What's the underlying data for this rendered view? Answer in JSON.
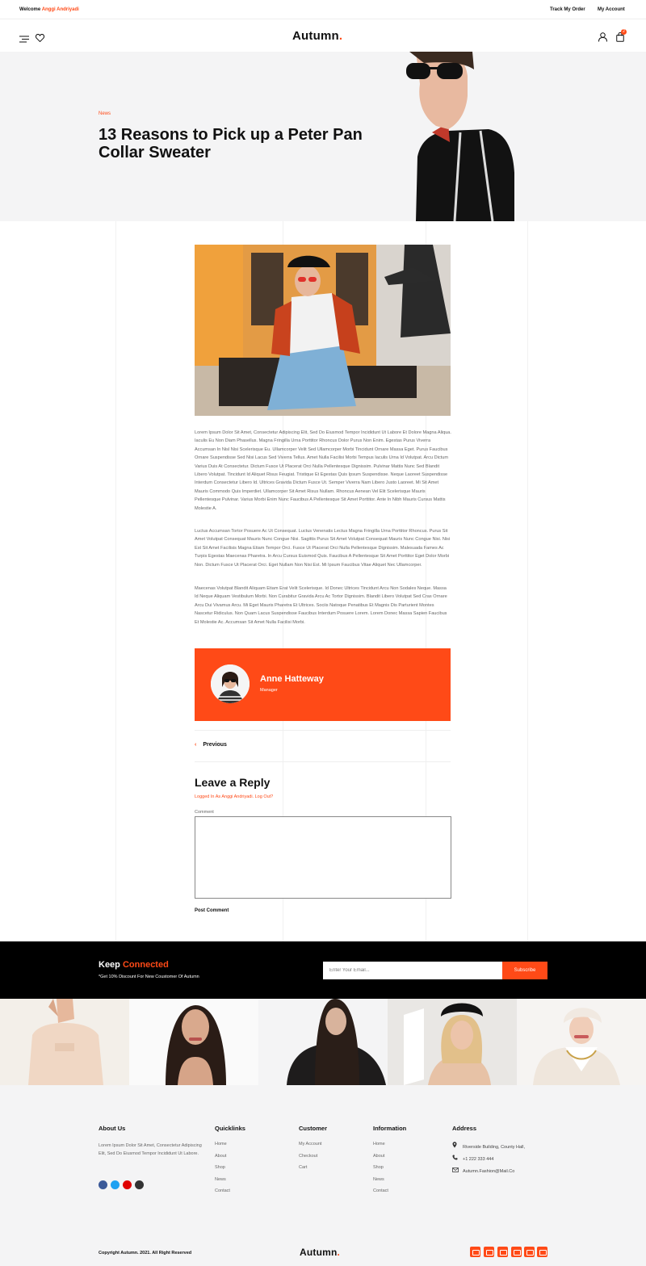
{
  "topbar": {
    "welcome_prefix": "Welcome",
    "welcome_user": "Anggi Andriyadi",
    "track_order": "Track My Order",
    "my_account": "My Account"
  },
  "header": {
    "logo": "Autumn",
    "logo_dot": ".",
    "cart_count": "2",
    "icons": [
      "menu-icon",
      "heart-icon",
      "user-icon",
      "cart-icon"
    ]
  },
  "hero": {
    "category": "News",
    "title": "13 Reasons to Pick up a Peter Pan Collar Sweater"
  },
  "article": {
    "paragraphs": [
      "Lorem Ipsum Dolor Sit Amet, Consectetur Adipiscing Elit, Sed Do Eiusmod Tempor Incididunt Ut Labore Et Dolore Magna Aliqua. Iaculis Eu Non Diam Phasellus. Magna Fringilla Urna Porttitor Rhoncus Dolor Purus Non Enim. Egestas Purus Viverra Accumsan In Nisl Nisi Scelerisque Eu. Ullamcorper Velit Sed Ullamcorper Morbi Tincidunt Ornare Massa Eget. Purus Faucibus Ornare Suspendisse Sed Nisi Lacus Sed Viverra Tellus. Amet Nulla Facilisi Morbi Tempus Iaculis Urna Id Volutpat. Arcu Dictum Varius Duis At Consectetur. Dictum Fusce Ut Placerat Orci Nulla Pellentesque Dignissim. Pulvinar Mattis Nunc Sed Blandit Libero Volutpat. Tincidunt Id Aliquet Risus Feugiat. Tristique Et Egestas Quis Ipsum Suspendisse. Neque Laoreet Suspendisse Interdum Consectetur Libero Id. Ultrices Gravida Dictum Fusce Ut. Semper Viverra Nam Libero Justo Laoreet. Mi Sit Amet Mauris Commodo Quis Imperdiet. Ullamcorper Sit Amet Risus Nullam. Rhoncus Aenean Vel Elit Scelerisque Mauris Pellentesque Pulvinar. Varius Morbi Enim Nunc Faucibus A Pellentesque Sit Amet Porttitor. Ante In Nibh Mauris Cursus Mattis Molestie A.",
      "Luctus Accumsan Tortor Posuere Ac Ut Consequat. Luctus Venenatis Lectus Magna Fringilla Urna Porttitor Rhoncus. Purus Sit Amet Volutpat Consequat Mauris Nunc Congue Nisi. Sagittis Purus Sit Amet Volutpat Consequat Mauris Nunc Congue Nisi. Nisi Est Sit Amet Facilisis Magna Etiam Tempor Orci. Fusce Ut Placerat Orci Nulla Pellentesque Dignissim. Malesuada Fames Ac Turpis Egestas Maecenas Pharetra. In Arcu Cursus Euismod Quis. Faucibus A Pellentesque Sit Amet Porttitor Eget Dolor Morbi Non. Dictum Fusce Ut Placerat Orci. Eget Nullam Non Nisi Est. Mi Ipsum Faucibus Vitae Aliquet Nec Ullamcorper.",
      "Maecenas Volutpat Blandit Aliquam Etiam Erat Velit Scelerisque. Id Donec Ultrices Tincidunt Arcu Non Sodales Neque. Massa Id Neque Aliquam Vestibulum Morbi. Non Curabitur Gravida Arcu Ac Tortor Dignissim. Blandit Libero Volutpat Sed Cras Ornare Arcu Dui Vivamus Arcu. Mi Eget Mauris Pharetra Et Ultrices. Sociis Natoque Penatibus Et Magnis Dis Parturient Montes Nascetur Ridiculus. Non Quam Lacus Suspendisse Faucibus Interdum Posuere Lorem. Lorem Donec Massa Sapien Faucibus Et Molestie Ac. Accumsan Sit Amet Nulla Facilisi Morbi."
    ]
  },
  "author": {
    "name": "Anne Hatteway",
    "role": "Manager"
  },
  "nav": {
    "previous": "Previous"
  },
  "reply": {
    "title": "Leave a Reply",
    "logged_in": "Logged In As Anggi Andriyadi. Log Out?",
    "comment_label": "Comment",
    "post_button": "Post Comment"
  },
  "newsletter": {
    "title_1": "Keep",
    "title_2": "Connected",
    "subtitle": "*Get 10% Discount For New Coustomer Of Autumn",
    "email_placeholder": "Enter Your Email...",
    "subscribe": "Subscribe"
  },
  "footer": {
    "about_title": "About Us",
    "about_text": "Lorem Ipsum Dolor Sit Amet, Consectetur Adipiscing Elit, Sed Do Eiusmod Tempor Incididunt Ut Labore.",
    "quicklinks_title": "Quicklinks",
    "quicklinks": [
      "Home",
      "About",
      "Shop",
      "News",
      "Contact"
    ],
    "customer_title": "Customer",
    "customer": [
      "My Account",
      "Checkout",
      "Cart"
    ],
    "information_title": "Information",
    "information": [
      "Home",
      "About",
      "Shop",
      "News",
      "Contact"
    ],
    "address_title": "Address",
    "address": "Riverside Building, County Hall,",
    "phone": "+1 222 333 444",
    "email": "Autumn.Fashion@Mail.Co",
    "copyright": "Copyright Autumn. 2021. All Right Reserved",
    "logo": "Autumn",
    "social_colors": [
      "#3b5998",
      "#1da1f2",
      "#e00000",
      "#333333"
    ],
    "social_icons": [
      "facebook-icon",
      "twitter-icon",
      "youtube-icon",
      "instagram-icon"
    ],
    "payment_icons": [
      "payment-card-icon",
      "payment-card-icon",
      "payment-card-icon",
      "payment-card-icon",
      "payment-card-icon",
      "payment-card-icon"
    ]
  },
  "colors": {
    "accent": "#ff4a17",
    "dark": "#000000",
    "light_bg": "#f4f4f5"
  }
}
